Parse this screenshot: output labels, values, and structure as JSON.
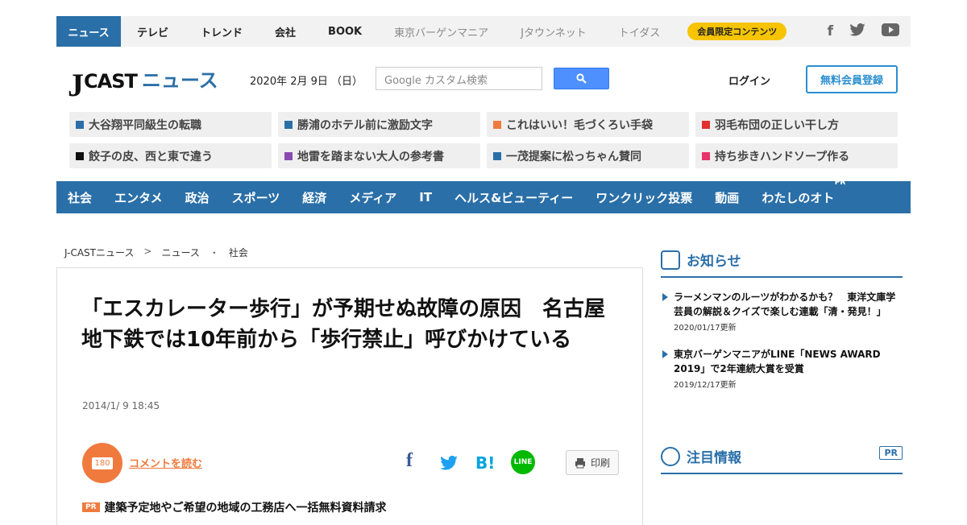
{
  "topnav": {
    "items": [
      {
        "label": "ニュース",
        "active": true
      },
      {
        "label": "テレビ"
      },
      {
        "label": "トレンド"
      },
      {
        "label": "会社"
      },
      {
        "label": "BOOK"
      },
      {
        "label": "東京バーゲンマニア",
        "grey": true
      },
      {
        "label": "Jタウンネット",
        "grey": true
      },
      {
        "label": "トイダス",
        "grey": true
      }
    ],
    "member_label": "会員限定コンテンツ",
    "social": [
      "facebook-icon",
      "twitter-icon",
      "youtube-icon"
    ]
  },
  "header": {
    "logo_j": "J",
    "logo_cast": "CAST",
    "logo_news": "ニュース",
    "date": "2020年 2月 9日 （日）",
    "search_placeholder": "Google カスタム検索",
    "login": "ログイン",
    "register": "無料会員登録"
  },
  "tags": [
    {
      "label": "大谷翔平同級生の転職",
      "color": "#2a6fa8"
    },
    {
      "label": "勝浦のホテル前に激励文字",
      "color": "#2a6fa8"
    },
    {
      "label": "これはいい！毛づくろい手袋",
      "color": "#f07a3e"
    },
    {
      "label": "羽毛布団の正しい干し方",
      "color": "#e03030"
    },
    {
      "label": "餃子の皮、西と東で違う",
      "color": "#111111"
    },
    {
      "label": "地雷を踏まない大人の参考書",
      "color": "#8a4ab0"
    },
    {
      "label": "一茂提案に松っちゃん賛同",
      "color": "#2a6fa8"
    },
    {
      "label": "持ち歩きハンドソープ作る",
      "color": "#e8336d"
    }
  ],
  "categories": [
    "社会",
    "エンタメ",
    "政治",
    "スポーツ",
    "経済",
    "メディア",
    "IT",
    "ヘルス&ビューティー",
    "ワンクリック投票",
    "動画",
    "わたしのオト"
  ],
  "category_pr": "PR",
  "breadcrumb": [
    "J-CASTニュース",
    ">",
    "ニュース",
    "・",
    "社会"
  ],
  "article": {
    "title": "「エスカレーター歩行」が予期せぬ故障の原因　名古屋地下鉄では10年前から「歩行禁止」呼びかけている",
    "date": "2014/1/ 9 18:45",
    "comment_count": "180",
    "comment_link": "コメントを読む",
    "print": "印刷",
    "share": [
      {
        "icon": "facebook-icon",
        "glyph": "f",
        "color": "#3b5998"
      },
      {
        "icon": "twitter-icon",
        "glyph": "t",
        "color": "#1da1f2"
      },
      {
        "icon": "hatena-icon",
        "glyph": "B!",
        "color": "#00a4de"
      },
      {
        "icon": "line-icon",
        "glyph": "LINE",
        "color": "#00b900"
      }
    ],
    "ad_badge": "PR",
    "ad_text": "建築予定地やご希望の地域の工務店へ一括無料資料請求"
  },
  "sidebar": {
    "notice_title": "お知らせ",
    "notices": [
      {
        "text": "ラーメンマンのルーツがわかるかも？　東洋文庫学芸員の解説＆クイズで楽しむ連載「清・発見！」",
        "updated": "2020/01/17更新"
      },
      {
        "text": "東京バーゲンマニアがLINE「NEWS AWARD 2019」で2年連続大賞を受賞",
        "updated": "2019/12/17更新"
      }
    ],
    "featured_title": "注目情報",
    "featured_pr": "PR"
  }
}
